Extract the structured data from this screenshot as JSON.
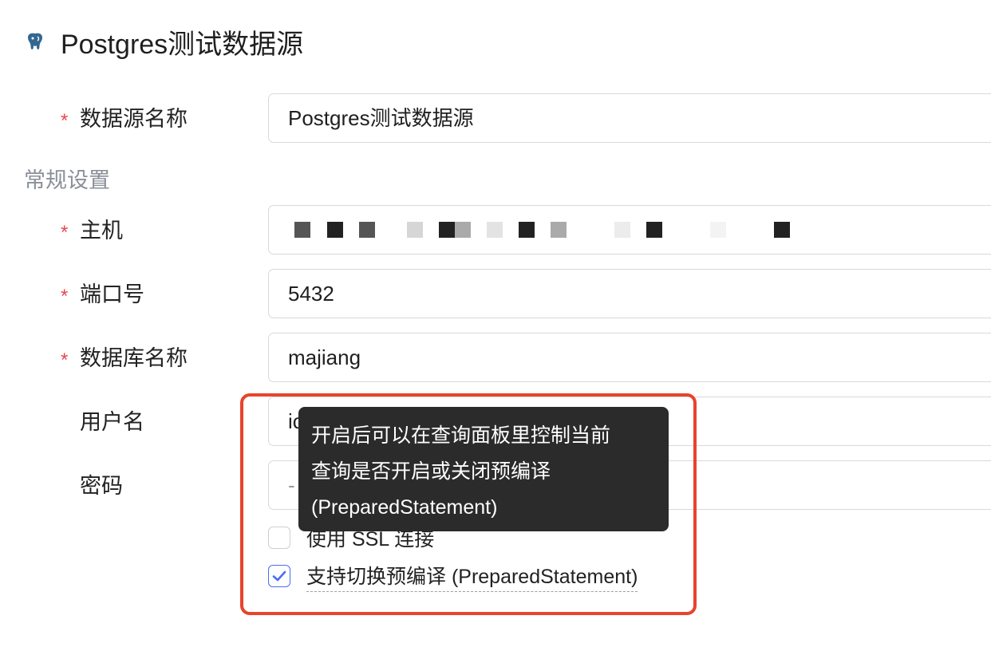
{
  "header": {
    "title": "Postgres测试数据源",
    "icon": "postgresql-elephant-icon"
  },
  "form": {
    "datasource_name": {
      "label": "数据源名称",
      "value": "Postgres测试数据源",
      "required": true
    },
    "section_general": "常规设置",
    "host": {
      "label": "主机",
      "value": "",
      "required": true,
      "redacted": true
    },
    "port": {
      "label": "端口号",
      "value": "5432",
      "required": true
    },
    "database_name": {
      "label": "数据库名称",
      "value": "majiang",
      "required": true
    },
    "username": {
      "label": "用户名",
      "value": "ic",
      "required": false
    },
    "password": {
      "label": "密码",
      "value": "-",
      "required": false
    },
    "ssl": {
      "label": "使用 SSL 连接",
      "checked": false
    },
    "prepared": {
      "label": "支持切换预编译 (PreparedStatement)",
      "checked": true
    }
  },
  "tooltip": {
    "line1": "开启后可以在查询面板里控制当前",
    "line2": "查询是否开启或关闭预编译",
    "line3": "(PreparedStatement)"
  },
  "colors": {
    "required_asterisk": "#e5484d",
    "highlight_border": "#e8432d",
    "checkbox_accent": "#4a6cf7",
    "tooltip_bg": "#2b2b2b"
  }
}
